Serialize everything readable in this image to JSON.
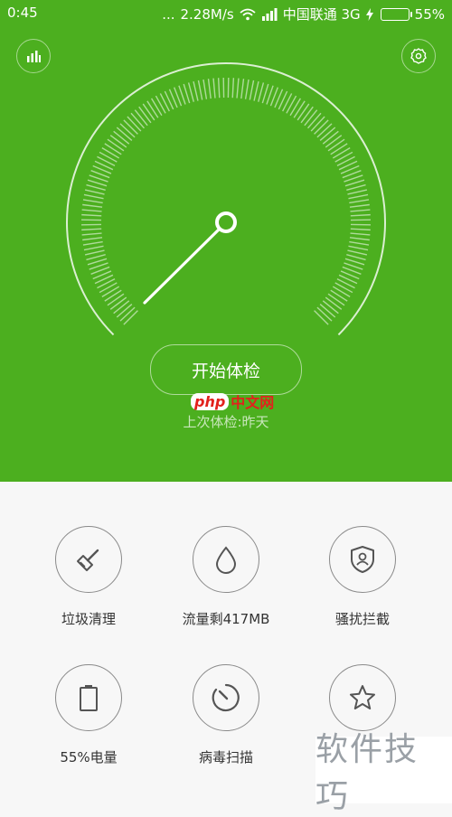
{
  "status": {
    "time": "0:45",
    "dots": "...",
    "speed": "2.28M/s",
    "carrier": "中国联通 3G",
    "battery": "55%"
  },
  "gauge": {
    "start_label": "开始体检",
    "last_check": "上次体检:昨天"
  },
  "watermark": {
    "php": "php",
    "cn": "中文网",
    "corner": "软件技巧"
  },
  "tools": [
    {
      "label": "垃圾清理",
      "icon": "broom-icon"
    },
    {
      "label": "流量剩417MB",
      "icon": "droplet-icon"
    },
    {
      "label": "骚扰拦截",
      "icon": "shield-user-icon"
    },
    {
      "label": "55%电量",
      "icon": "battery-icon"
    },
    {
      "label": "病毒扫描",
      "icon": "scan-icon"
    },
    {
      "label": "",
      "icon": "star-icon"
    }
  ],
  "colors": {
    "accent": "#4caf1f"
  }
}
